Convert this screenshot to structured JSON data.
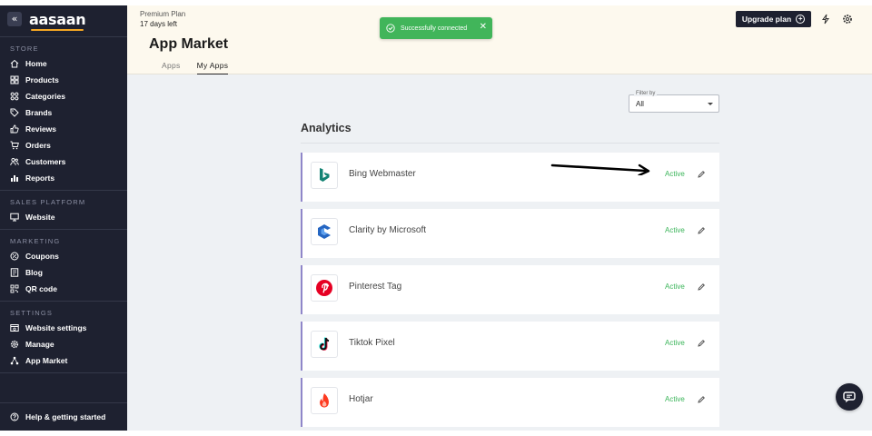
{
  "brand": {
    "logo_text": "aasaan",
    "collapse_icon": "«"
  },
  "sidebar": {
    "sections": [
      {
        "title": "STORE",
        "items": [
          {
            "label": "Home",
            "icon": "home-icon"
          },
          {
            "label": "Products",
            "icon": "products-icon"
          },
          {
            "label": "Categories",
            "icon": "categories-icon"
          },
          {
            "label": "Brands",
            "icon": "tag-icon"
          },
          {
            "label": "Reviews",
            "icon": "thumbs-up-icon"
          },
          {
            "label": "Orders",
            "icon": "cart-icon"
          },
          {
            "label": "Customers",
            "icon": "users-icon"
          },
          {
            "label": "Reports",
            "icon": "bar-chart-icon"
          }
        ]
      },
      {
        "title": "SALES PLATFORM",
        "items": [
          {
            "label": "Website",
            "icon": "monitor-icon"
          }
        ]
      },
      {
        "title": "MARKETING",
        "items": [
          {
            "label": "Coupons",
            "icon": "coupon-icon"
          },
          {
            "label": "Blog",
            "icon": "blog-icon"
          },
          {
            "label": "QR code",
            "icon": "qr-code-icon"
          }
        ]
      },
      {
        "title": "SETTINGS",
        "items": [
          {
            "label": "Website settings",
            "icon": "browser-settings-icon"
          },
          {
            "label": "Manage",
            "icon": "gear-icon"
          },
          {
            "label": "App Market",
            "icon": "app-market-icon"
          }
        ]
      }
    ],
    "help": {
      "label": "Help & getting started",
      "icon": "help-icon"
    }
  },
  "header": {
    "plan_name": "Premium Plan",
    "plan_days": "17 days left",
    "title": "App Market",
    "tabs": [
      {
        "label": "Apps",
        "active": false
      },
      {
        "label": "My Apps",
        "active": true
      }
    ],
    "upgrade_label": "Upgrade plan",
    "icons": [
      "lightning-icon",
      "gear-icon"
    ]
  },
  "toast": {
    "message": "Successfully connected",
    "close": "✕",
    "color": "#41b55a"
  },
  "filter": {
    "label": "Filter by",
    "value": "All"
  },
  "section": {
    "title": "Analytics"
  },
  "apps": [
    {
      "name": "Bing Webmaster",
      "status": "Active",
      "logo": "bing-logo"
    },
    {
      "name": "Clarity by Microsoft",
      "status": "Active",
      "logo": "clarity-logo"
    },
    {
      "name": "Pinterest Tag",
      "status": "Active",
      "logo": "pinterest-logo"
    },
    {
      "name": "Tiktok Pixel",
      "status": "Active",
      "logo": "tiktok-logo"
    },
    {
      "name": "Hotjar",
      "status": "Active",
      "logo": "hotjar-logo"
    }
  ],
  "colors": {
    "sidebar_bg": "#1e2130",
    "header_bg": "#fdf9ee",
    "main_bg": "#eef1f4",
    "active_status": "#3bb55a",
    "card_accent": "#8f86c9"
  }
}
